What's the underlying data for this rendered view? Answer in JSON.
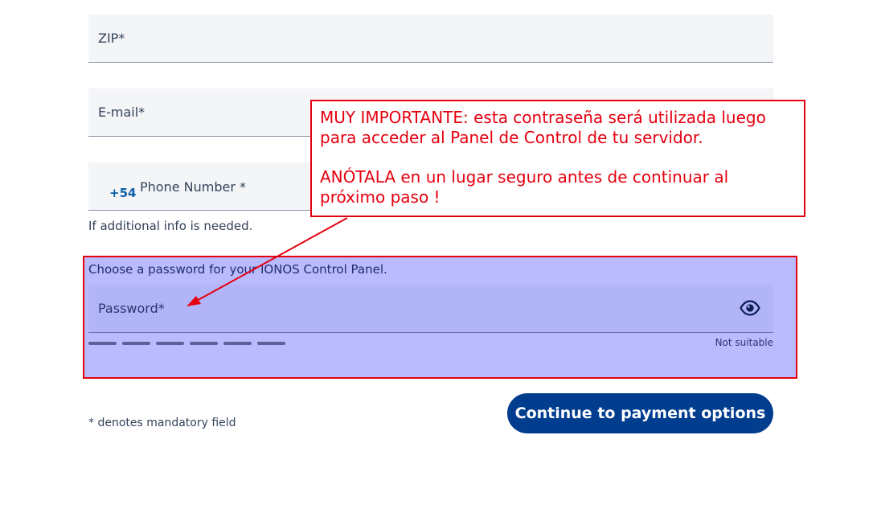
{
  "form": {
    "zip_label": "ZIP*",
    "email_label": "E-mail*",
    "phone_prefix": "+54",
    "phone_label": "Phone Number *",
    "phone_hint": "If additional info is needed.",
    "password_intro": "Choose a password for your IONOS Control Panel.",
    "password_label": "Password*",
    "password_strength_label": "Not suitable",
    "mandatory_note": "* denotes mandatory field",
    "continue_label": "Continue to payment options"
  },
  "annotation": {
    "line1": "MUY IMPORTANTE: esta contraseña será utilizada luego para acceder al Panel de Control de tu servidor.",
    "line2": "ANÓTALA en un lugar seguro antes de continuar al próximo paso !"
  },
  "icons": {
    "password_toggle": "eye-icon"
  },
  "colors": {
    "annotation_red": "#e5000f",
    "highlight": "#babafe",
    "button": "#003d8f"
  }
}
